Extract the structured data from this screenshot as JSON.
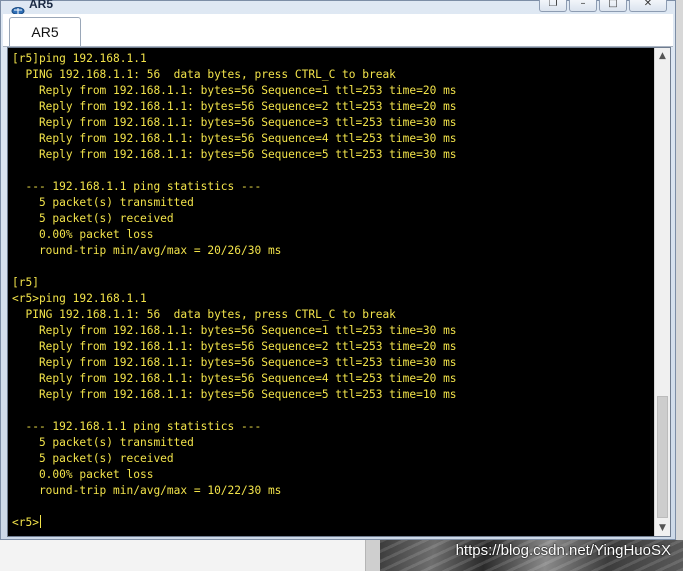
{
  "window": {
    "title": "AR5",
    "controls": {
      "minimize": "–",
      "maximize": "□",
      "close": "✕"
    },
    "restore": "❐"
  },
  "tabs": [
    {
      "label": "AR5",
      "active": true
    }
  ],
  "console": {
    "lines": [
      "[r5]ping 192.168.1.1",
      "  PING 192.168.1.1: 56  data bytes, press CTRL_C to break",
      "    Reply from 192.168.1.1: bytes=56 Sequence=1 ttl=253 time=20 ms",
      "    Reply from 192.168.1.1: bytes=56 Sequence=2 ttl=253 time=20 ms",
      "    Reply from 192.168.1.1: bytes=56 Sequence=3 ttl=253 time=30 ms",
      "    Reply from 192.168.1.1: bytes=56 Sequence=4 ttl=253 time=30 ms",
      "    Reply from 192.168.1.1: bytes=56 Sequence=5 ttl=253 time=30 ms",
      "",
      "  --- 192.168.1.1 ping statistics ---",
      "    5 packet(s) transmitted",
      "    5 packet(s) received",
      "    0.00% packet loss",
      "    round-trip min/avg/max = 20/26/30 ms",
      "",
      "[r5]",
      "<r5>ping 192.168.1.1",
      "  PING 192.168.1.1: 56  data bytes, press CTRL_C to break",
      "    Reply from 192.168.1.1: bytes=56 Sequence=1 ttl=253 time=30 ms",
      "    Reply from 192.168.1.1: bytes=56 Sequence=2 ttl=253 time=20 ms",
      "    Reply from 192.168.1.1: bytes=56 Sequence=3 ttl=253 time=30 ms",
      "    Reply from 192.168.1.1: bytes=56 Sequence=4 ttl=253 time=20 ms",
      "    Reply from 192.168.1.1: bytes=56 Sequence=5 ttl=253 time=10 ms",
      "",
      "  --- 192.168.1.1 ping statistics ---",
      "    5 packet(s) transmitted",
      "    5 packet(s) received",
      "    0.00% packet loss",
      "    round-trip min/avg/max = 10/22/30 ms",
      ""
    ],
    "prompt": "<r5>",
    "text_color": "#f2e34a",
    "background_color": "#000000"
  },
  "scrollbar": {
    "up_arrow": "▲",
    "down_arrow": "▼"
  },
  "watermark": "https://blog.csdn.net/YingHuoSX"
}
